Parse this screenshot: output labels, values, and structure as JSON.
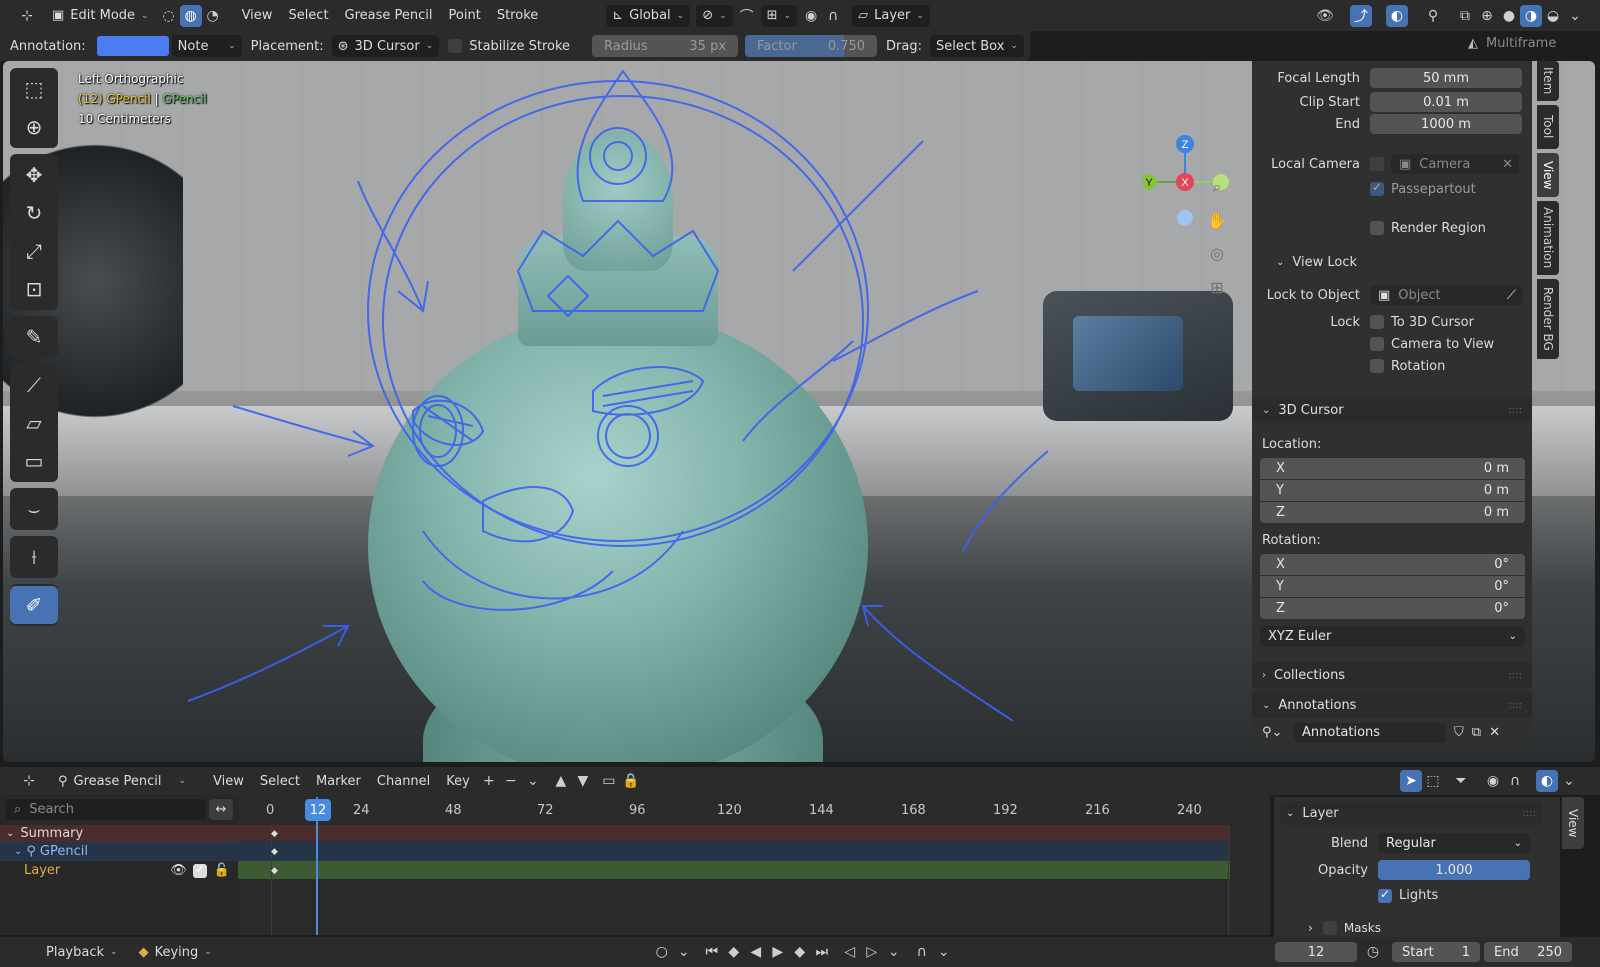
{
  "header": {
    "mode": "Edit Mode",
    "menus": [
      "View",
      "Select",
      "Grease Pencil",
      "Point",
      "Stroke"
    ],
    "transform_orientation": "Global",
    "layer_label": "Layer"
  },
  "tool_settings": {
    "annotation_label": "Annotation:",
    "annotation_color": "#4c7cf2",
    "note": "Note",
    "placement_label": "Placement:",
    "placement": "3D Cursor",
    "stabilize": "Stabilize Stroke",
    "radius_label": "Radius",
    "radius_value": "35 px",
    "factor_label": "Factor",
    "factor_value": "0.750",
    "drag_label": "Drag:",
    "drag_value": "Select Box",
    "multiframe": "Multiframe"
  },
  "viewport": {
    "view_name": "Left Orthographic",
    "object_prefix": "(12) GPencil",
    "object_sep": "|",
    "object_layer": "GPencil",
    "scale": "10 Centimeters",
    "gizmo": {
      "z": "Z",
      "y": "Y",
      "x": "X"
    }
  },
  "side_tabs": [
    "Item",
    "Tool",
    "View",
    "Animation",
    "Render BG"
  ],
  "view_panel": {
    "focal_length_label": "Focal Length",
    "focal_length": "50 mm",
    "clip_start_label": "Clip Start",
    "clip_start": "0.01 m",
    "end_label": "End",
    "end": "1000 m",
    "local_camera_label": "Local Camera",
    "camera": "Camera",
    "passepartout": "Passepartout",
    "render_region": "Render Region",
    "view_lock": "View Lock",
    "lock_to_object_label": "Lock to Object",
    "object": "Object",
    "lock_label": "Lock",
    "to_3d_cursor": "To 3D Cursor",
    "camera_to_view": "Camera to View",
    "rotation": "Rotation"
  },
  "cursor_panel": {
    "title": "3D Cursor",
    "location_label": "Location:",
    "location": [
      {
        "axis": "X",
        "value": "0 m"
      },
      {
        "axis": "Y",
        "value": "0 m"
      },
      {
        "axis": "Z",
        "value": "0 m"
      }
    ],
    "rotation_label": "Rotation:",
    "rotation": [
      {
        "axis": "X",
        "value": "0°"
      },
      {
        "axis": "Y",
        "value": "0°"
      },
      {
        "axis": "Z",
        "value": "0°"
      }
    ],
    "rotation_mode": "XYZ Euler"
  },
  "collections": "Collections",
  "annotations_panel": {
    "title": "Annotations",
    "value": "Annotations"
  },
  "timeline": {
    "editor": "Grease Pencil",
    "menus": [
      "View",
      "Select",
      "Marker",
      "Channel",
      "Key"
    ],
    "search_placeholder": "Search",
    "current_frame": "12",
    "ticks": [
      "0",
      "24",
      "48",
      "72",
      "96",
      "120",
      "144",
      "168",
      "192",
      "216",
      "240"
    ],
    "channels": {
      "summary": "Summary",
      "gpencil": "GPencil",
      "layer": "Layer"
    }
  },
  "layer_panel": {
    "title": "Layer",
    "blend_label": "Blend",
    "blend": "Regular",
    "opacity_label": "Opacity",
    "opacity": "1.000",
    "lights": "Lights",
    "masks": "Masks",
    "view_tab": "View"
  },
  "bottom": {
    "playback": "Playback",
    "keying": "Keying",
    "frame": "12",
    "start_label": "Start",
    "start": "1",
    "end_label": "End",
    "end": "250"
  }
}
